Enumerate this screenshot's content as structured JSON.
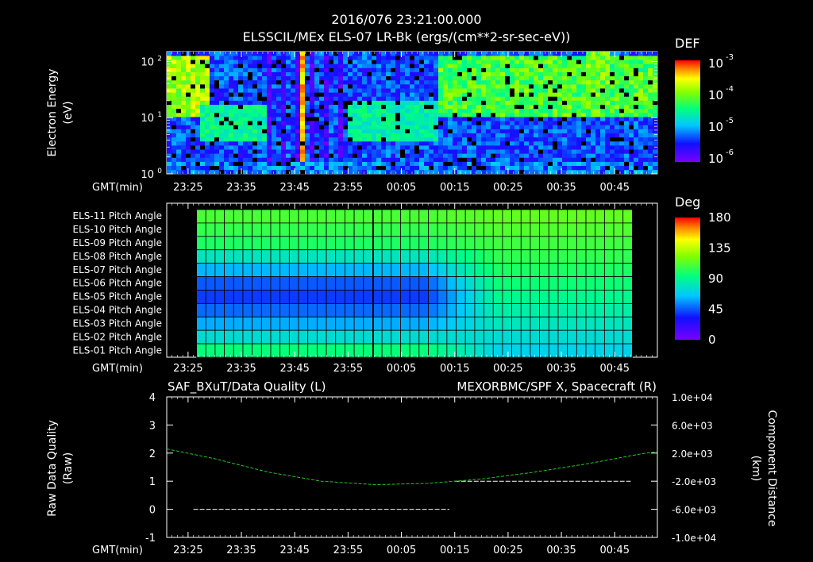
{
  "header": {
    "timestamp": "2016/076 23:21:00.000",
    "title": "ELSSCIL/MEx ELS-07 LR-Bk  (ergs/(cm**2-sr-sec-eV))"
  },
  "colors": {
    "background": "#000000",
    "text": "#ffffff",
    "grid": "#000000",
    "right_axis_series": "#22c822",
    "left_axis_series": "#ffffff"
  },
  "chart_data": [
    {
      "id": "energy-spectrogram",
      "type": "heatmap",
      "ylabel": "Electron Energy\n(eV)",
      "ylabel_lines": [
        "Electron Energy",
        "(eV)"
      ],
      "yscale": "log",
      "ylim": [
        1,
        150
      ],
      "yticks": [
        {
          "value": 100,
          "base": "10",
          "exp": "2"
        },
        {
          "value": 10,
          "base": "10",
          "exp": "1"
        },
        {
          "value": 1,
          "base": "10",
          "exp": "0"
        }
      ],
      "xlabel": "GMT(min)",
      "xticks": [
        "23:25",
        "23:35",
        "23:45",
        "23:55",
        "00:05",
        "00:15",
        "00:25",
        "00:35",
        "00:45"
      ],
      "colorbar": {
        "label": "DEF",
        "scale": "log",
        "ticks": [
          {
            "base": "10",
            "exp": "-3"
          },
          {
            "base": "10",
            "exp": "-4"
          },
          {
            "base": "10",
            "exp": "-5"
          },
          {
            "base": "10",
            "exp": "-6"
          }
        ],
        "range": [
          1e-06,
          0.001
        ]
      }
    },
    {
      "id": "pitch-angle",
      "type": "heatmap",
      "xlabel": "GMT(min)",
      "xticks": [
        "23:25",
        "23:35",
        "23:45",
        "23:55",
        "00:05",
        "00:15",
        "00:25",
        "00:35",
        "00:45"
      ],
      "rows": [
        "ELS-11 Pitch Angle",
        "ELS-10 Pitch Angle",
        "ELS-09 Pitch Angle",
        "ELS-08 Pitch Angle",
        "ELS-07 Pitch Angle",
        "ELS-06 Pitch Angle",
        "ELS-05 Pitch Angle",
        "ELS-04 Pitch Angle",
        "ELS-03 Pitch Angle",
        "ELS-02 Pitch Angle",
        "ELS-01 Pitch Angle"
      ],
      "values_before_transition_deg": [
        110,
        105,
        100,
        80,
        62,
        45,
        40,
        48,
        60,
        75,
        95
      ],
      "values_after_transition_deg": [
        115,
        112,
        108,
        104,
        100,
        96,
        90,
        85,
        80,
        75,
        70
      ],
      "transition_time": "00:12",
      "colorbar": {
        "label": "Deg",
        "ticks": [
          "180",
          "135",
          "90",
          "45",
          "0"
        ],
        "range": [
          0,
          180
        ]
      }
    },
    {
      "id": "data-quality",
      "type": "line",
      "left_title": "SAF_BXuT/Data Quality (L)",
      "right_title": "MEXORBMC/SPF X, Spacecraft (R)",
      "ylabel_left": "Raw Data Quality\n(Raw)",
      "ylabel_left_lines": [
        "Raw Data Quality",
        "(Raw)"
      ],
      "ylabel_right": "Component Distance\n(km)",
      "ylabel_right_lines": [
        "Component Distance",
        "(km)"
      ],
      "ylim_left": [
        -1,
        4
      ],
      "yticks_left": [
        "4",
        "3",
        "2",
        "1",
        "0",
        "-1"
      ],
      "ylim_right": [
        -10000,
        10000
      ],
      "yticks_right": [
        "1.0e+04",
        "6.0e+03",
        "2.0e+03",
        "-2.0e+03",
        "-6.0e+03",
        "-1.0e+04"
      ],
      "xlabel": "GMT(min)",
      "xticks": [
        "23:25",
        "23:35",
        "23:45",
        "23:55",
        "00:05",
        "00:15",
        "00:25",
        "00:35",
        "00:45"
      ],
      "series": [
        {
          "axis": "left",
          "points": [
            {
              "x": "23:26",
              "y": 0
            },
            {
              "x": "00:14",
              "y": 0
            },
            {
              "x": "00:15",
              "y": 1
            },
            {
              "x": "00:48",
              "y": 1
            }
          ]
        },
        {
          "axis": "right",
          "points": [
            {
              "x": "23:21",
              "y": 2600
            },
            {
              "x": "23:30",
              "y": 1200
            },
            {
              "x": "23:40",
              "y": -700
            },
            {
              "x": "23:50",
              "y": -2000
            },
            {
              "x": "00:00",
              "y": -2500
            },
            {
              "x": "00:10",
              "y": -2300
            },
            {
              "x": "00:20",
              "y": -1700
            },
            {
              "x": "00:30",
              "y": -700
            },
            {
              "x": "00:40",
              "y": 500
            },
            {
              "x": "00:50",
              "y": 1900
            },
            {
              "x": "00:53",
              "y": 2200
            }
          ]
        }
      ]
    }
  ]
}
